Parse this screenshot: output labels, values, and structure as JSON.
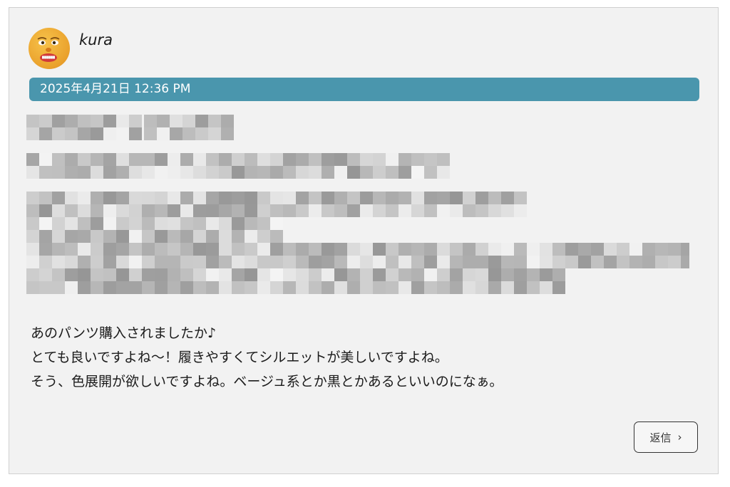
{
  "comment": {
    "username": "kura",
    "avatar_icon": "face-emoji-icon",
    "date": "2025年4月21日 12:36 PM",
    "message_lines": [
      "あのパンツ購入されましたか♪",
      "とても良いですよね〜！履きやすくてシルエットが美しいですよね。",
      "そう、色展開が欲しいですよね。ベージュ系とか黒とかあるといいのになぁ。"
    ],
    "reply_label": "返信",
    "reply_chevron": "›"
  },
  "colors": {
    "date_bar": "#4a96ad",
    "card_background": "#f2f2f2"
  }
}
